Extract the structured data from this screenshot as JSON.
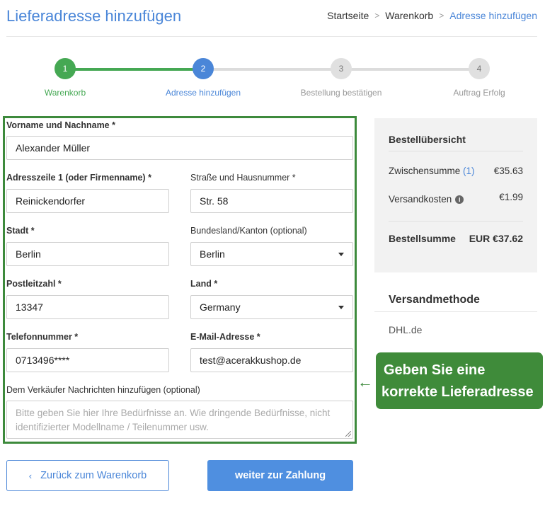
{
  "header": {
    "title": "Lieferadresse hinzufügen",
    "breadcrumb": [
      "Startseite",
      "Warenkorb",
      "Adresse hinzufügen"
    ],
    "separator": ">"
  },
  "stepper": {
    "steps": [
      {
        "number": "1",
        "label": "Warenkorb",
        "state": "done"
      },
      {
        "number": "2",
        "label": "Adresse hinzufügen",
        "state": "active"
      },
      {
        "number": "3",
        "label": "Bestellung bestätigen",
        "state": "todo"
      },
      {
        "number": "4",
        "label": "Auftrag Erfolg",
        "state": "todo"
      }
    ],
    "colors": {
      "done": "#45a853",
      "active": "#4a86d8",
      "todo": "#e0e0e0"
    }
  },
  "form": {
    "name": {
      "label": "Vorname und Nachname *",
      "value": "Alexander Müller"
    },
    "address1": {
      "label": "Adresszeile 1 (oder Firmenname) *",
      "value": "Reinickendorfer"
    },
    "street": {
      "label": "Straße und Hausnummer *",
      "value": "Str. 58"
    },
    "city": {
      "label": "Stadt *",
      "value": "Berlin"
    },
    "state": {
      "label": "Bundesland/Kanton (optional)",
      "value": "Berlin"
    },
    "zip": {
      "label": "Postleitzahl *",
      "value": "13347"
    },
    "country": {
      "label": "Land *",
      "value": "Germany"
    },
    "phone": {
      "label": "Telefonnummer *",
      "value": "0713496****"
    },
    "email": {
      "label": "E-Mail-Adresse *",
      "value": "test@acerakkushop.de"
    },
    "message": {
      "label": "Dem Verkäufer Nachrichten hinzufügen (optional)",
      "placeholder": "Bitte geben Sie hier Ihre Bedürfnisse an. Wie dringende Bedürfnisse, nicht identifizierter Modellname / Teilenummer usw."
    }
  },
  "summary": {
    "title": "Bestellübersicht",
    "subtotal_label": "Zwischensumme",
    "subtotal_count": "(1)",
    "subtotal_value": "€35.63",
    "shipping_label": "Versandkosten",
    "shipping_value": "€1.99",
    "total_label": "Bestellsumme",
    "total_value": "EUR €37.62"
  },
  "shipping": {
    "title": "Versandmethode",
    "method": "DHL.de"
  },
  "callout": {
    "line1": "Geben Sie eine",
    "line2": "korrekte Lieferadresse",
    "color": "#3f8b3a"
  },
  "buttons": {
    "back_label": "Zurück zum Warenkorb",
    "next_label": "weiter zur Zahlung"
  },
  "icons": {
    "back": "chevron-left-icon",
    "dropdown": "caret-down-icon",
    "info": "info-icon",
    "arrow": "arrow-left-icon"
  }
}
